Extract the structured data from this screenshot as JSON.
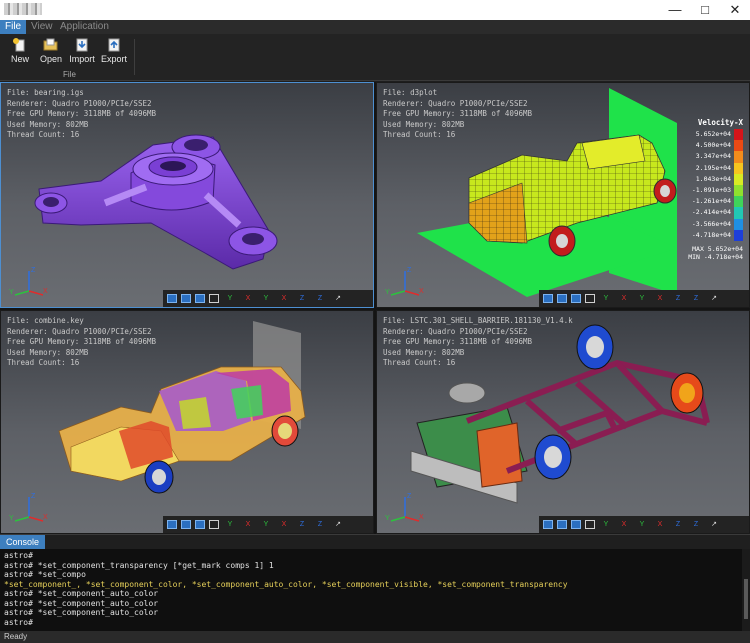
{
  "menubar": {
    "items": [
      "File",
      "View",
      "Application"
    ]
  },
  "ribbon": {
    "buttons": [
      "New",
      "Open",
      "Import",
      "Export"
    ],
    "group_label": "File"
  },
  "views": [
    {
      "lines": [
        "File: bearing.igs",
        "Renderer: Quadro P1000/PCIe/SSE2",
        "Free GPU Memory: 3118MB of 4096MB",
        "Used Memory: 802MB",
        "Thread Count: 16"
      ]
    },
    {
      "lines": [
        "File: d3plot",
        "Renderer: Quadro P1000/PCIe/SSE2",
        "Free GPU Memory: 3118MB of 4096MB",
        "Used Memory: 802MB",
        "Thread Count: 16"
      ]
    },
    {
      "lines": [
        "File: combine.key",
        "Renderer: Quadro P1000/PCIe/SSE2",
        "Free GPU Memory: 3118MB of 4096MB",
        "Used Memory: 802MB",
        "Thread Count: 16"
      ]
    },
    {
      "lines": [
        "File: LSTC.301_SHELL_BARRIER.181130_V1.4.k",
        "Renderer: Quadro P1000/PCIe/SSE2",
        "Free GPU Memory: 3118MB of 4096MB",
        "Used Memory: 802MB",
        "Thread Count: 16"
      ]
    }
  ],
  "legend": {
    "title": "Velocity-X",
    "values": [
      "5.652e+04",
      "4.500e+04",
      "3.347e+04",
      "2.195e+04",
      "1.043e+04",
      "-1.091e+03",
      "-1.261e+04",
      "-2.414e+04",
      "-3.566e+04",
      "-4.718e+04"
    ],
    "max": "MAX 5.652e+04",
    "min": "MIN -4.718e+04",
    "colors": [
      "#d4141a",
      "#ea4a14",
      "#f28c1c",
      "#f6c51f",
      "#d8ea24",
      "#8fe02e",
      "#3fd35a",
      "#21c7b4",
      "#1f8fe2",
      "#1d3fd9"
    ]
  },
  "view_toolbar": {
    "icons": [
      "solid-view-icon",
      "solid-view-icon",
      "solid-view-icon",
      "wireframe-icon",
      "view-y-plus-icon",
      "view-y-minus-icon",
      "view-x-plus-icon",
      "view-x-minus-icon",
      "view-z-plus-icon",
      "view-z-minus-icon",
      "view-iso-icon"
    ],
    "labels": [
      "Y",
      "X",
      "Y",
      "X",
      "Z",
      "Z"
    ]
  },
  "axes": {
    "x": "X",
    "y": "Y",
    "z": "Z"
  },
  "console": {
    "tab": "Console",
    "lines": [
      "astro#",
      "astro# *set_component_transparency [*get_mark comps 1] 1",
      "astro# *set_compo",
      "astro# *set_component_auto_color",
      "astro# *set_component_auto_color",
      "astro# *set_component_auto_color",
      "astro#"
    ],
    "hint": "*set_component_, *set_component_color, *set_component_auto_color, *set_component_visible, *set_component_transparency"
  },
  "status": "Ready",
  "colors": {
    "accent": "#3d7fbf",
    "mesh_green": "#1fe24a",
    "purple_part": "#7a3fd4"
  }
}
